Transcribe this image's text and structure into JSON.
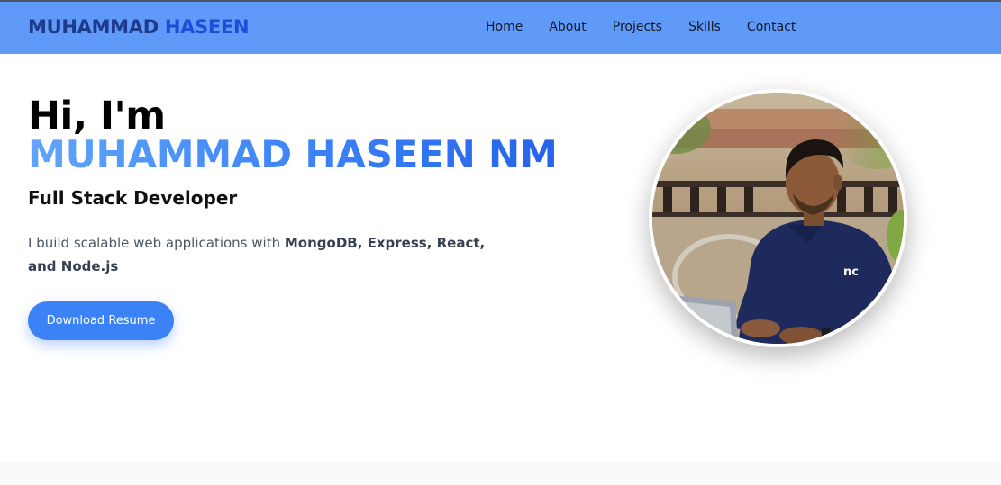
{
  "nav": {
    "brand_first": "MUHAMMAD",
    "brand_second": "HASEEN",
    "links": [
      "Home",
      "About",
      "Projects",
      "Skills",
      "Contact"
    ]
  },
  "hero": {
    "greeting": "Hi, I'm",
    "name": "MUHAMMAD HASEEN NM",
    "role": "Full Stack Developer",
    "desc_prefix": "I build scalable web applications with ",
    "desc_bold": "MongoDB, Express, React, and Node.js",
    "button_label": "Download Resume",
    "shirt_logo": "nc"
  },
  "colors": {
    "navbar": "#609af8",
    "accent": "#3b82f6",
    "brand_dark": "#1e3a8a",
    "brand_blue": "#1d4ed8"
  },
  "icons": {
    "profile": "profile-photo"
  }
}
